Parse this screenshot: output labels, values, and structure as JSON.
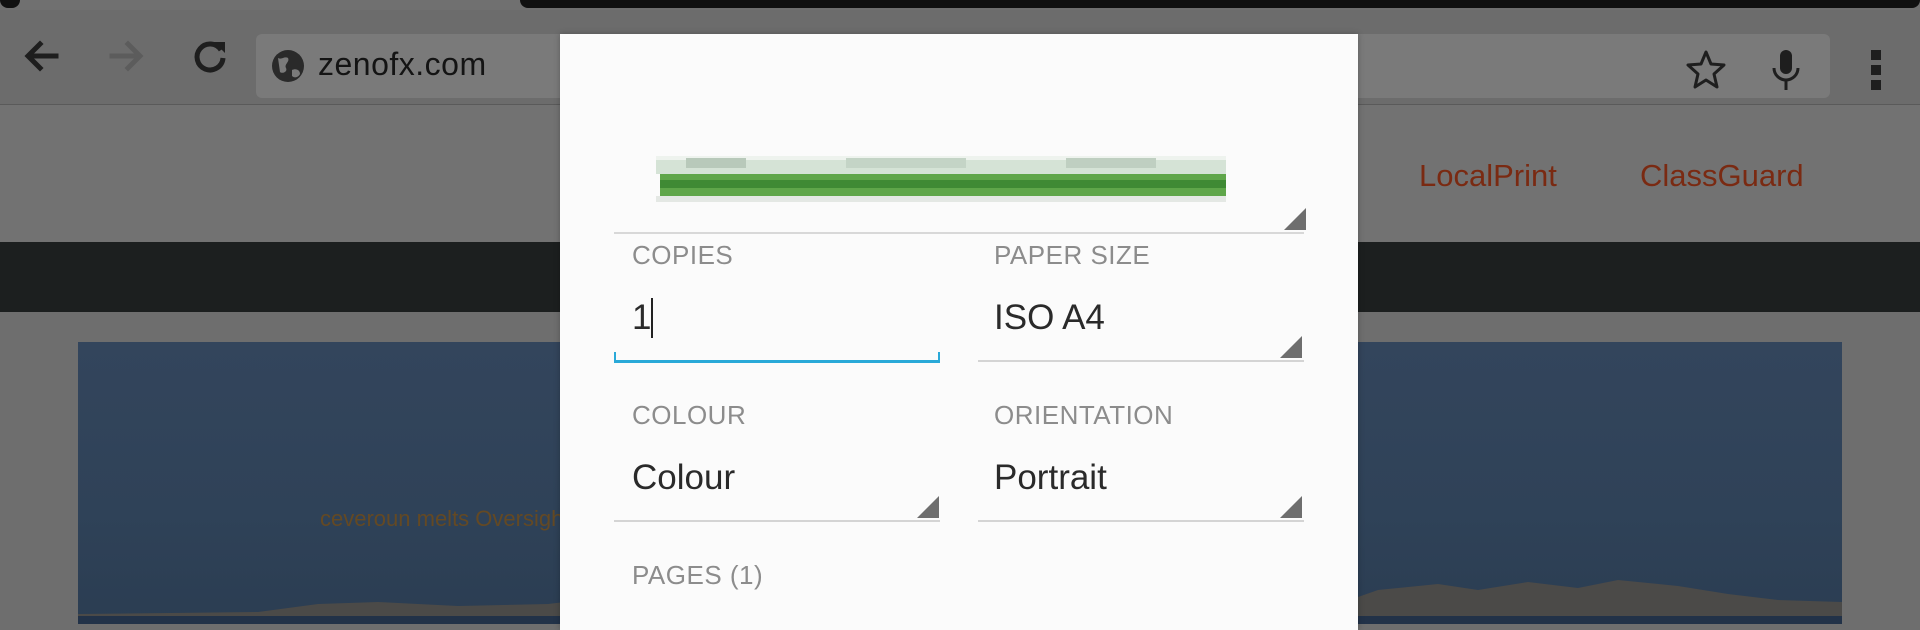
{
  "browser": {
    "url": "zenofx.com",
    "icons": {
      "back": "arrow-left-icon",
      "forward": "arrow-right-icon",
      "reload": "reload-icon",
      "site": "globe-icon",
      "bookmark": "star-icon",
      "voice": "microphone-icon",
      "menu": "overflow-menu-icon"
    }
  },
  "site": {
    "links": [
      "LocalPrint",
      "ClassGuard"
    ],
    "hero_caption": "ceveroun melts Oversighe"
  },
  "print_dialog": {
    "copies": {
      "label": "COPIES",
      "value": "1"
    },
    "paper_size": {
      "label": "PAPER SIZE",
      "value": "ISO A4"
    },
    "colour": {
      "label": "COLOUR",
      "value": "Colour"
    },
    "orientation": {
      "label": "ORIENTATION",
      "value": "Portrait"
    },
    "pages": {
      "label": "PAGES (1)"
    }
  },
  "colors": {
    "accent": "#2aa9d8",
    "link": "#7a2a12",
    "dialog_bg": "#fbfbfb"
  }
}
